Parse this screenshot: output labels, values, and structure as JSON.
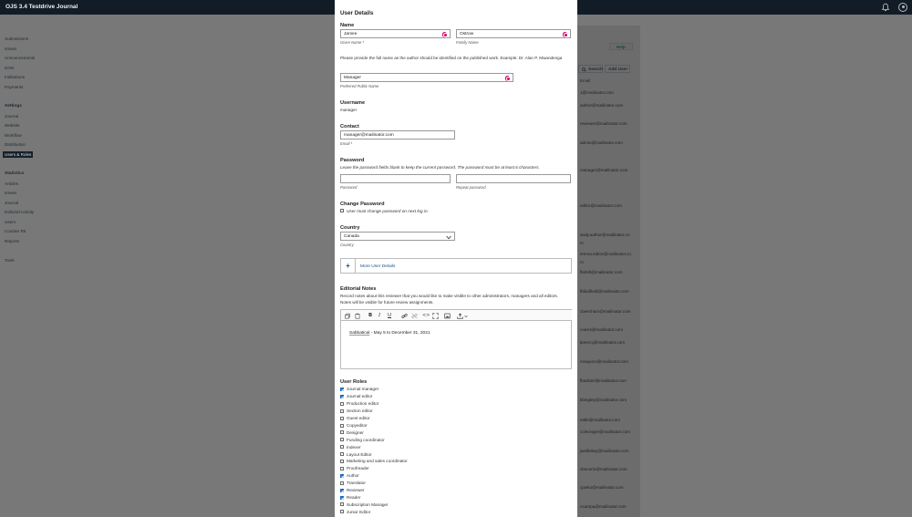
{
  "app": {
    "title": "OJS 3.4 Testdrive Journal"
  },
  "nav": {
    "items": [
      {
        "label": "Submissions",
        "y": 24
      },
      {
        "label": "Issues",
        "y": 35
      },
      {
        "label": "Announcements",
        "y": 45
      },
      {
        "label": "DOIs",
        "y": 56
      },
      {
        "label": "Institutions",
        "y": 66
      },
      {
        "label": "Payments",
        "y": 77
      }
    ],
    "settings_heading": "Settings",
    "settings": [
      "Journal",
      "Website",
      "Workflow",
      "Distribution",
      "Users & Roles"
    ],
    "statistics_heading": "Statistics",
    "statistics": [
      "Articles",
      "Issues",
      "Journal",
      "Editorial Activity",
      "Users",
      "Counter R5",
      "Reports"
    ],
    "tools": "Tools"
  },
  "background": {
    "help_label": "Help",
    "search_label": "Search",
    "add_user_label": "Add User",
    "email_header": "Email",
    "emails": [
      "1@mailinator.com",
      "author@mailinator.com",
      "reviewer@mailinator.com",
      "admin@mailinator.com",
      "manager@mailinator.com",
      "editor@mailinator.com",
      "andy.author@mailinator.com",
      "emma.editor@mailinator.com",
      "fbirkitt@mailinator.com",
      "fblindfield@mailinator.com",
      "cbeecham@mailinator.com",
      "rvares@mailinator.com",
      "lpeercy@mailinator.com",
      "mvayuno@mailinator.com",
      "fbarbieri@mailinator.com",
      "kbingley@mailinator.com",
      "ealle@mailinator.com",
      "cclevinger@mailinator.com",
      "jwellinksy@mailinator.com",
      "vbecerio@mailinator.com",
      "cjaeko@mailinator.com",
      "ncampa@mailinator.com"
    ]
  },
  "modal": {
    "heading": "User Details",
    "name_section": "Name",
    "given_name_value": "Jamee",
    "given_name_label": "Given Name",
    "family_name_value": "Ostrow",
    "family_name_label": "Family Name",
    "name_help": "Please provide the full name as the author should be identified on the published work. Example: Dr. Alan P. Mwandenga",
    "preferred_value": "Manager",
    "preferred_label": "Preferred Public Name",
    "username_section": "Username",
    "username_value": "manager",
    "contact_section": "Contact",
    "email_value": "manager@mailinator.com",
    "email_label": "Email",
    "password_section": "Password",
    "password_help": "Leave the password fields blank to keep the current password. The password must be at least 6 characters.",
    "password_label": "Password",
    "repeat_password_label": "Repeat password",
    "change_password_section": "Change Password",
    "change_password_option": "User must change password on next log in.",
    "country_section": "Country",
    "country_value": "Canada",
    "country_label": "Country",
    "more_details": "More User Details",
    "editorial_section": "Editorial Notes",
    "editorial_help": "Record notes about this reviewer that you would like to make visible to other administrators, managers and all editors. Notes will be visible for future review assignments.",
    "editorial_spell": "Sabbatical",
    "editorial_rest": " - May 5 to December 31, 2021",
    "roles_section": "User Roles",
    "roles": [
      {
        "label": "Journal manager",
        "checked": true
      },
      {
        "label": "Journal editor",
        "checked": true
      },
      {
        "label": "Production editor",
        "checked": false
      },
      {
        "label": "Section editor",
        "checked": false
      },
      {
        "label": "Guest editor",
        "checked": false
      },
      {
        "label": "Copyeditor",
        "checked": false
      },
      {
        "label": "Designer",
        "checked": false
      },
      {
        "label": "Funding coordinator",
        "checked": false
      },
      {
        "label": "Indexer",
        "checked": false
      },
      {
        "label": "Layout Editor",
        "checked": false
      },
      {
        "label": "Marketing and sales coordinator",
        "checked": false
      },
      {
        "label": "Proofreader",
        "checked": false
      },
      {
        "label": "Author",
        "checked": true
      },
      {
        "label": "Translator",
        "checked": false
      },
      {
        "label": "Reviewer",
        "checked": true
      },
      {
        "label": "Reader",
        "checked": true
      },
      {
        "label": "Subscription Manager",
        "checked": false
      },
      {
        "label": "Junior Editor",
        "checked": false
      }
    ]
  },
  "colors": {
    "accent": "#1a6bc4",
    "globe": "#d0086d",
    "topbar": "#121c26"
  }
}
